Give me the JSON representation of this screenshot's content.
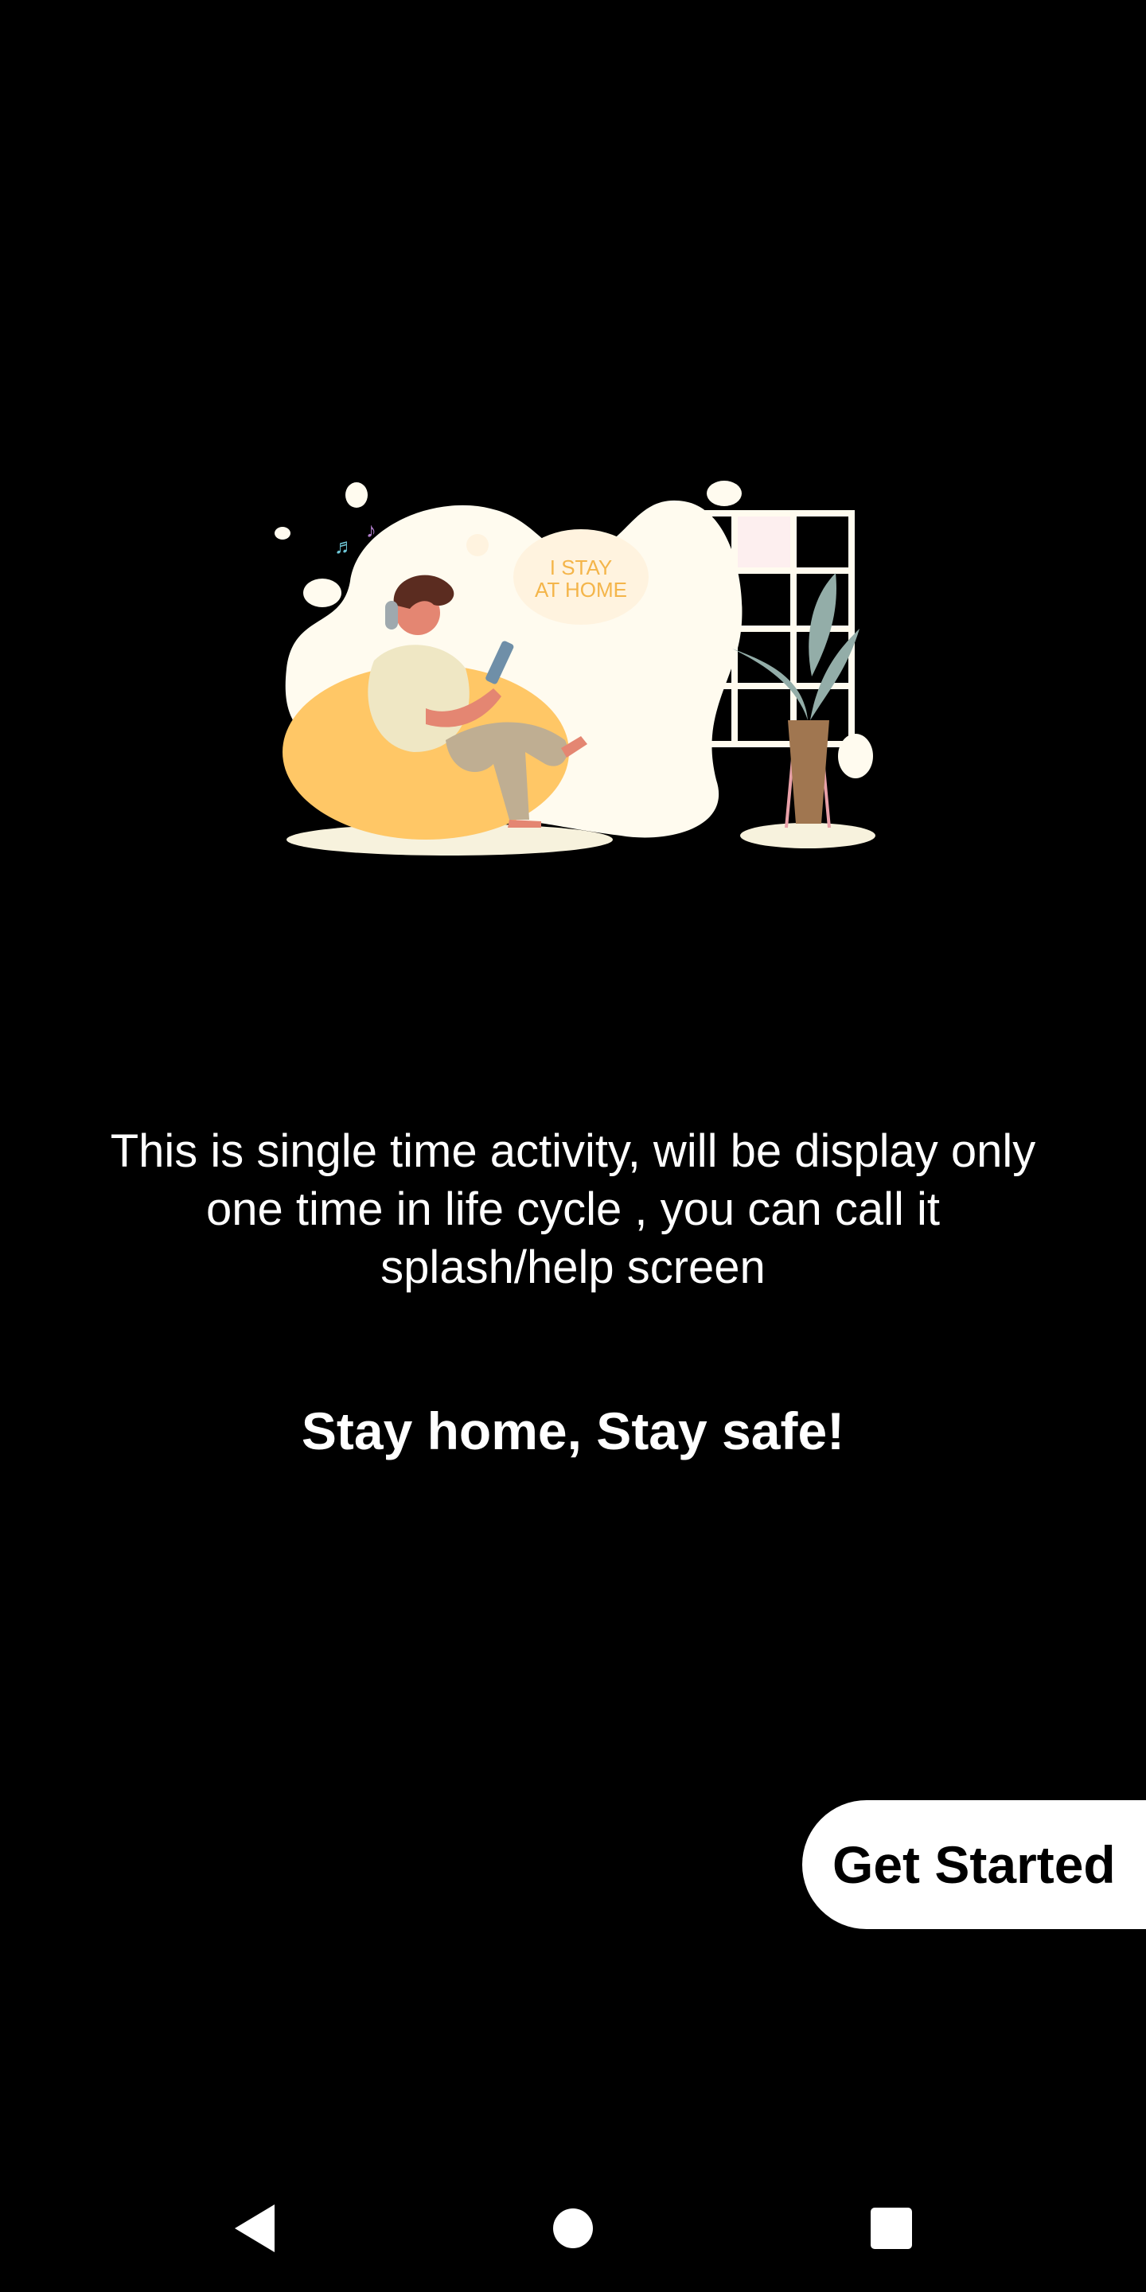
{
  "illustration": {
    "bubble_text_line1": "I STAY",
    "bubble_text_line2": "AT HOME",
    "icon": "person-on-beanbag-illustration"
  },
  "content": {
    "description": "This is single time activity, will be display only one time in life cycle , you can call it splash/help screen",
    "tagline": "Stay home, Stay safe!"
  },
  "actions": {
    "get_started_label": "Get Started"
  },
  "navbar": {
    "back_icon": "back-triangle-icon",
    "home_icon": "home-circle-icon",
    "recent_icon": "recent-apps-square-icon"
  },
  "colors": {
    "background": "#000000",
    "text": "#ffffff",
    "button_bg": "#ffffff",
    "button_text": "#000000",
    "accent_yellow": "#FFC766",
    "cream": "#FFFBEF"
  }
}
